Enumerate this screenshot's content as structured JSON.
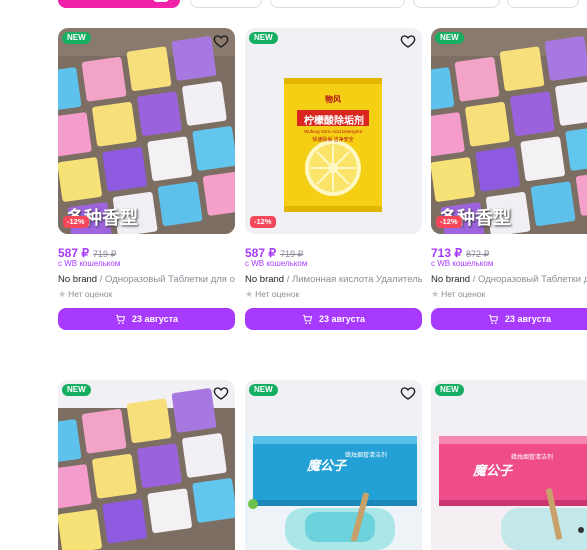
{
  "filter_chips": [
    "",
    "",
    "",
    "",
    ""
  ],
  "products": [
    {
      "badge": "NEW",
      "discount": "-12%",
      "price": "587 ₽",
      "old_price": "719 ₽",
      "wallet_note": "с WB кошельком",
      "brand": "No brand",
      "separator": " / ",
      "name": "Одноразовый Таблетки для о…",
      "rating_text": "Нет оценок",
      "button_label": "23 августа",
      "image_caption": "多种香型",
      "image_kind": "sachets"
    },
    {
      "badge": "NEW",
      "discount": "-12%",
      "price": "587 ₽",
      "old_price": "719 ₽",
      "wallet_note": "с WB кошельком",
      "brand": "No brand",
      "separator": " / ",
      "name": "Лимонная кислота Удалитель…",
      "rating_text": "Нет оценок",
      "button_label": "23 августа",
      "package_brand": "物风",
      "package_title": "柠檬酸除垢剂",
      "package_sub": "Wufeng Citric Acid Detergent",
      "package_tag": "快速除垢  洁净安全",
      "image_kind": "packet"
    },
    {
      "badge": "NEW",
      "discount": "-12%",
      "price": "713 ₽",
      "old_price": "872 ₽",
      "wallet_note": "с WB кошельком",
      "brand": "No brand",
      "separator": " / ",
      "name": "Одноразовый Таблетки для",
      "rating_text": "Нет оценок",
      "button_label": "23 августа",
      "image_caption": "多种香型",
      "image_kind": "sachets"
    },
    {
      "badge": "NEW",
      "image_kind": "sachets"
    },
    {
      "badge": "NEW",
      "box_title": "魔公子",
      "box_label": "蜡烛烟管清洁剂",
      "image_kind": "blue-box"
    },
    {
      "badge": "NEW",
      "box_title": "魔公子",
      "box_label": "蜡烛烟管清洁剂",
      "image_kind": "pink-box"
    }
  ],
  "colors": {
    "accent": "#a73afd",
    "new_badge": "#15ae62",
    "discount_badge": "#f5475a",
    "filter_active": "#f023a8"
  },
  "icons": {
    "favorite": "heart-outline-icon",
    "cart": "cart-icon",
    "rating": "star-icon"
  }
}
